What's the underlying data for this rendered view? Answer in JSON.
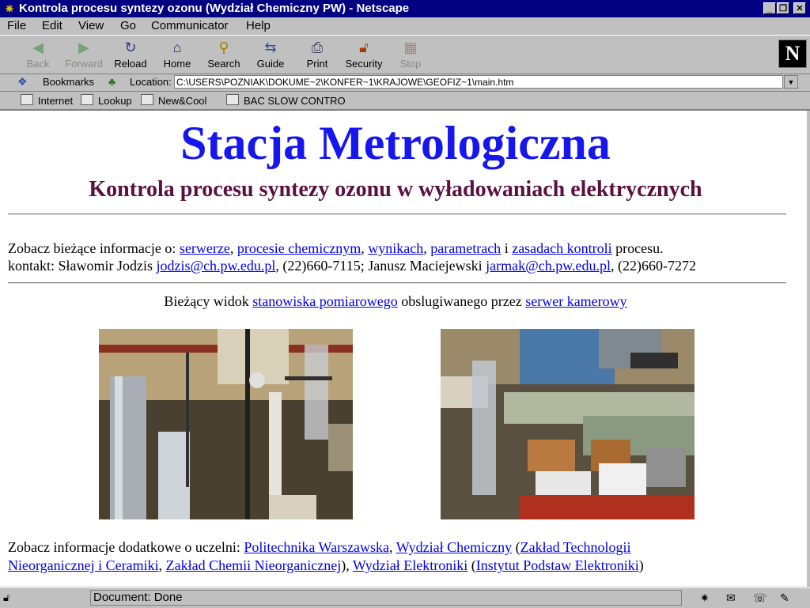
{
  "window": {
    "title": "Kontrola procesu syntezy ozonu (Wydział Chemiczny PW) - Netscape"
  },
  "menu": [
    "File",
    "Edit",
    "View",
    "Go",
    "Communicator",
    "Help"
  ],
  "toolbar": {
    "back": "Back",
    "forward": "Forward",
    "reload": "Reload",
    "home": "Home",
    "search": "Search",
    "guide": "Guide",
    "print": "Print",
    "security": "Security",
    "stop": "Stop"
  },
  "location": {
    "bookmarks": "Bookmarks",
    "label": "Location:",
    "url": "C:\\USERS\\POZNIAK\\DOKUME~2\\KONFER~1\\KRAJOWE\\GEOFIZ~1\\main.htm"
  },
  "personal": [
    "Internet",
    "Lookup",
    "New&Cool",
    "BAC SLOW CONTRO"
  ],
  "page": {
    "title": "Stacja Metrologiczna",
    "subtitle": "Kontrola procesu syntezy ozonu w wyładowaniach elektrycznych",
    "info": {
      "lead": "Zobacz bieżące informacje o: ",
      "l1": "serwerze",
      "s1": ", ",
      "l2": "procesie chemicznym",
      "s2": ", ",
      "l3": "wynikach",
      "s3": ", ",
      "l4": "parametrach",
      "s4": " i ",
      "l5": "zasadach kontroli",
      "tail": " procesu."
    },
    "contact": {
      "lead": "kontakt: Sławomir Jodzis ",
      "email1": " jodzis@ch.pw.edu.pl",
      "mid": ", (22)660-7115; Janusz Maciejewski ",
      "email2": " jarmak@ch.pw.edu.pl",
      "tail": ", (22)660-7272"
    },
    "view": {
      "lead": "Bieżący widok ",
      "l1": "stanowiska pomiarowego",
      "mid": " obslugiwanego przez ",
      "l2": "serwer kamerowy"
    },
    "extra": {
      "lead": " Zobacz informacje dodatkowe o uczelni: ",
      "l1": "Politechnika Warszawska",
      "s1": ", ",
      "l2": "Wydział Chemiczny",
      "s2": " (",
      "l3a": "Zakład Technologii",
      "l3b": "Nieorganicznej i Ceramiki",
      "s3": ", ",
      "l4": "Zakład Chemii Nieorganicznej",
      "s4": "), ",
      "l5": "Wydział Elektroniki",
      "s5": " (",
      "l6": "Instytut Podstaw Elektroniki",
      "tail": ")"
    }
  },
  "status": {
    "text": "Document: Done"
  }
}
